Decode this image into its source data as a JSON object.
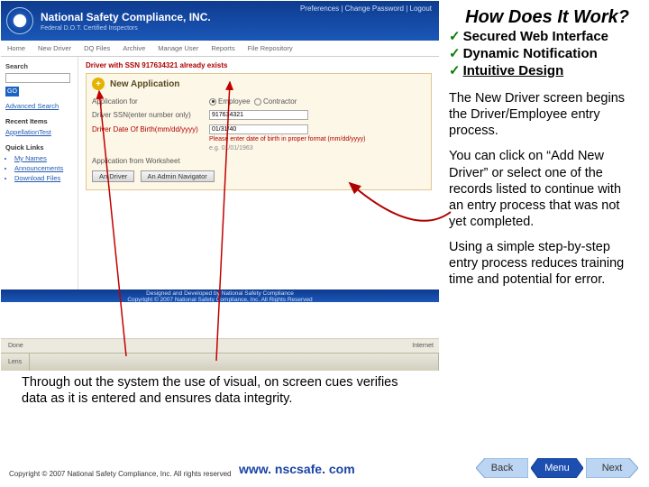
{
  "title": "How Does It Work?",
  "checks": {
    "c1": "Secured Web Interface",
    "c2": "Dynamic Notification",
    "c3": "Intuitive Design"
  },
  "body": {
    "p1": "The New Driver screen begins the Driver/Employee entry process.",
    "p2": "You can click on “Add New Driver” or select one of the records listed to continue with an entry process that was not yet completed.",
    "p3": "Using a simple step-by-step entry process reduces training time and potential for error."
  },
  "lower": "Through out the system the use of visual, on screen cues verifies data as it is entered and ensures data integrity.",
  "mock": {
    "brand": "National Safety Compliance, INC.",
    "sub": "Federal D.O.T. Certified Inspectors",
    "toplinks": "Preferences | Change Password | Logout",
    "nav": {
      "n1": "Home",
      "n2": "New Driver",
      "n3": "DQ Files",
      "n4": "Archive",
      "n5": "Manage User",
      "n6": "Reports",
      "n7": "File Repository"
    },
    "side": {
      "search": "Search",
      "go": "GO",
      "adv": "Advanced Search",
      "recent": "Recent Items",
      "recent1": "AppellationTest",
      "quick": "Quick Links",
      "q1": "My Names",
      "q2": "Announcements",
      "q3": "Download Files"
    },
    "error": "Driver with SSN 917634321 already exists",
    "panel": "New Application",
    "rows": {
      "r1l": "Application for",
      "r1a": "Employee",
      "r1b": "Contractor",
      "r2l": "Driver SSN(enter number only)",
      "r2v": "917634321",
      "r3l": "Driver Date Of Birth(mm/dd/yyyy)",
      "r3v": "01/31/40",
      "r3note": "Please enter date of birth in proper format (mm/dd/yyyy)",
      "r3eg": "e.g.  01/01/1963",
      "r4l": "Application from Worksheet",
      "b1": "An Driver",
      "b2": "An Admin Navigator"
    },
    "footer1": "Designed and Developed by National Safety Compliance",
    "footer2": "Copyright © 2007 National Safety Compliance, Inc. All Rights Reserved",
    "done": "Done",
    "inet": "Internet",
    "task": "Lens"
  },
  "footer": {
    "copy": "Copyright © 2007 National Safety Compliance, Inc. All rights reserved",
    "site": "www. nscsafe. com",
    "back": "Back",
    "menu": "Menu",
    "next": "Next"
  }
}
